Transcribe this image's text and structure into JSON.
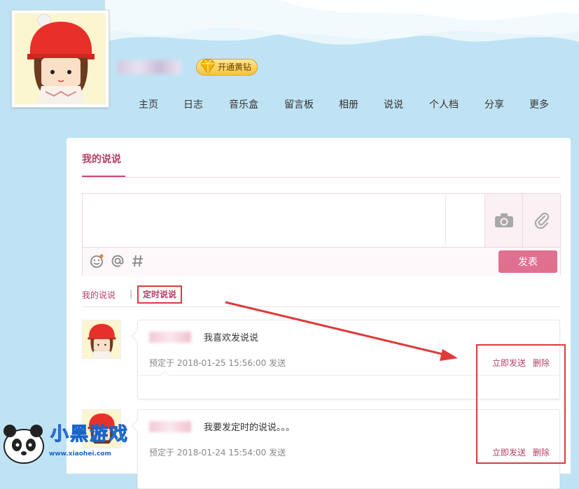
{
  "profile": {
    "vip_label": "开通黄钻"
  },
  "nav": {
    "items": [
      "主页",
      "日志",
      "音乐盒",
      "留言板",
      "相册",
      "说说",
      "个人档",
      "分享",
      "更多"
    ]
  },
  "panel": {
    "tab_label": "我的说说",
    "publish_label": "发表",
    "subtabs": {
      "mine": "我的说说",
      "separator": "|",
      "scheduled": "定时说说"
    }
  },
  "posts": [
    {
      "text": "我喜欢发说说",
      "meta": "预定于 2018-01-25 15:56:00 发送",
      "send_now": "立即发送",
      "delete": "删除"
    },
    {
      "text": "我要发定时的说说。。。",
      "meta": "预定于 2018-01-24 15:54:00 发送",
      "send_now": "立即发送",
      "delete": "删除"
    }
  ],
  "watermark": {
    "title": "小黑游戏",
    "url": "www.xiaohei.com"
  },
  "colors": {
    "accent": "#b83e64",
    "publish_button": "#e0708f",
    "annotation_red": "#e03a3a",
    "sky": "#bfe3f4"
  },
  "icons": [
    "camera-icon",
    "attachment-icon",
    "emoji-icon",
    "at-icon",
    "hashtag-icon",
    "diamond-icon"
  ]
}
